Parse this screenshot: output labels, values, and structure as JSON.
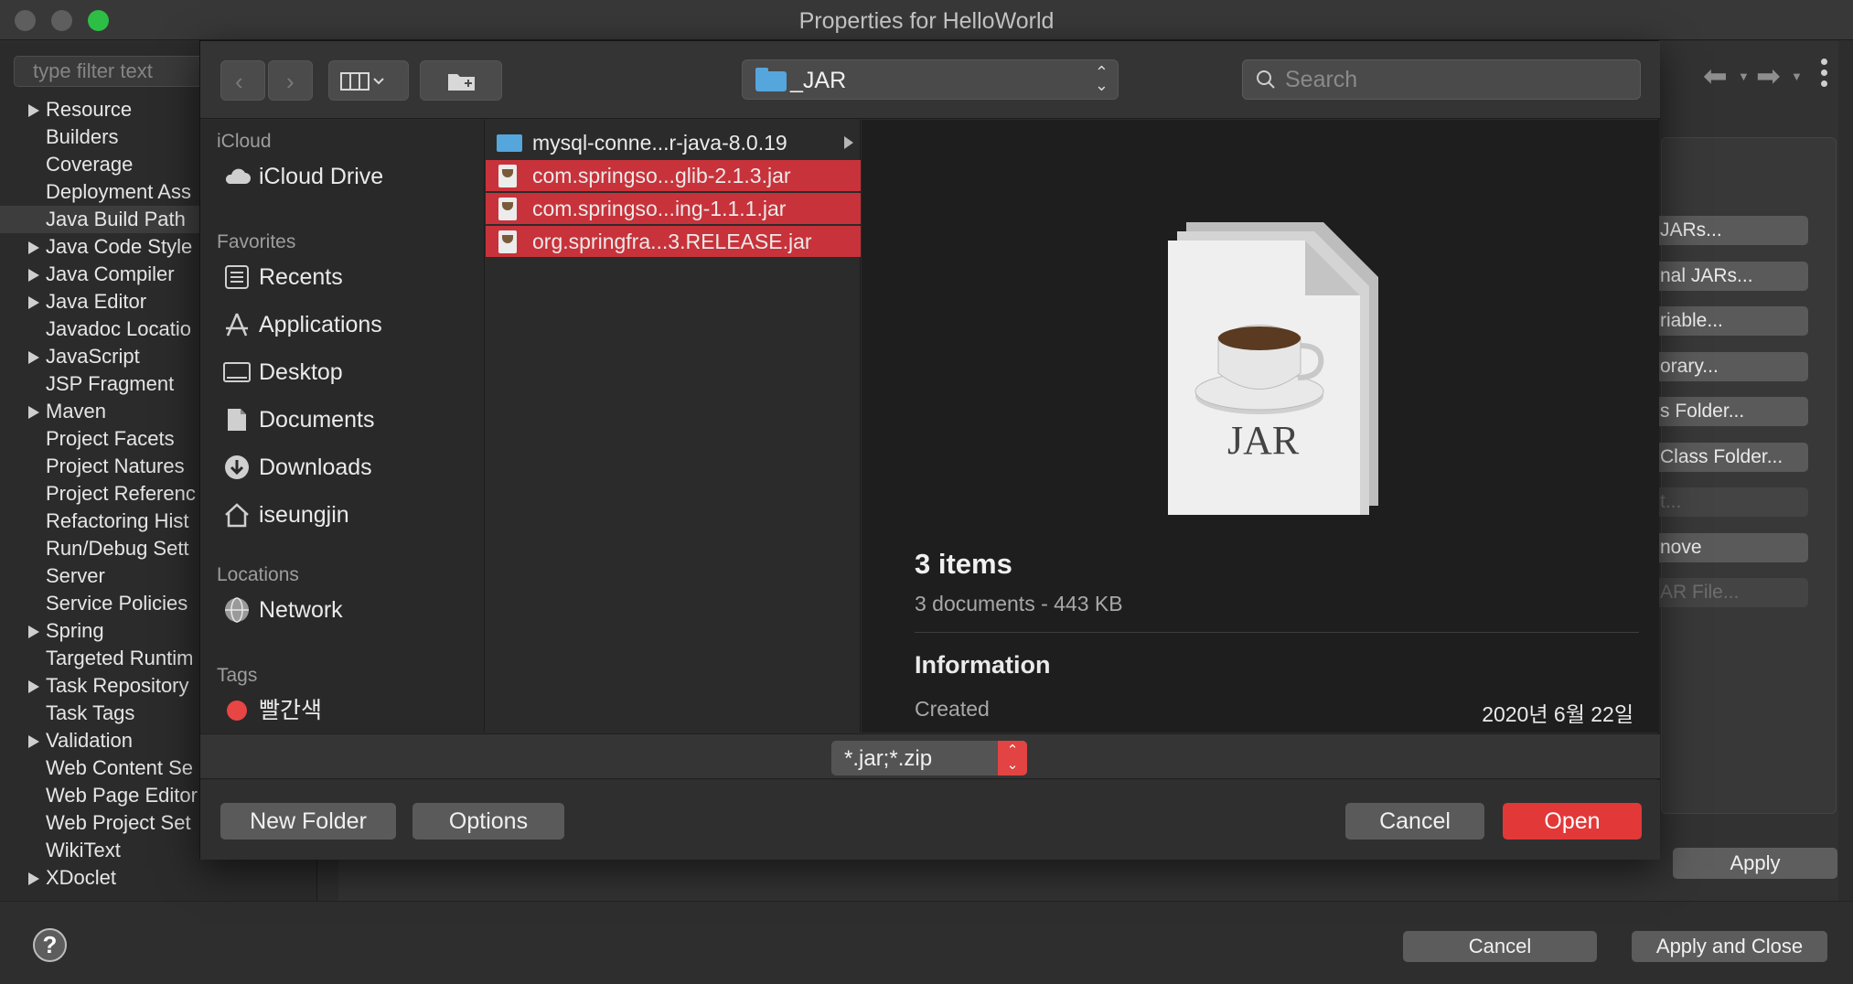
{
  "window": {
    "title": "Properties for HelloWorld"
  },
  "left_panel": {
    "filter_placeholder": "type filter text",
    "items": [
      {
        "label": "Resource",
        "expandable": true
      },
      {
        "label": "Builders",
        "expandable": false
      },
      {
        "label": "Coverage",
        "expandable": false
      },
      {
        "label": "Deployment Ass",
        "expandable": false
      },
      {
        "label": "Java Build Path",
        "expandable": false,
        "selected": true
      },
      {
        "label": "Java Code Style",
        "expandable": true
      },
      {
        "label": "Java Compiler",
        "expandable": true
      },
      {
        "label": "Java Editor",
        "expandable": true
      },
      {
        "label": "Javadoc Locatio",
        "expandable": false
      },
      {
        "label": "JavaScript",
        "expandable": true
      },
      {
        "label": "JSP Fragment",
        "expandable": false
      },
      {
        "label": "Maven",
        "expandable": true
      },
      {
        "label": "Project Facets",
        "expandable": false
      },
      {
        "label": "Project Natures",
        "expandable": false
      },
      {
        "label": "Project Referenc",
        "expandable": false
      },
      {
        "label": "Refactoring Hist",
        "expandable": false
      },
      {
        "label": "Run/Debug Sett",
        "expandable": false
      },
      {
        "label": "Server",
        "expandable": false
      },
      {
        "label": "Service Policies",
        "expandable": false
      },
      {
        "label": "Spring",
        "expandable": true
      },
      {
        "label": "Targeted Runtim",
        "expandable": false
      },
      {
        "label": "Task Repository",
        "expandable": true
      },
      {
        "label": "Task Tags",
        "expandable": false
      },
      {
        "label": "Validation",
        "expandable": true
      },
      {
        "label": "Web Content Se",
        "expandable": false
      },
      {
        "label": "Web Page Editor",
        "expandable": false
      },
      {
        "label": "Web Project Set",
        "expandable": false
      },
      {
        "label": "WikiText",
        "expandable": false
      },
      {
        "label": "XDoclet",
        "expandable": true
      }
    ]
  },
  "right_panel": {
    "side_buttons": [
      {
        "label": "JARs...",
        "disabled": false
      },
      {
        "label": "nal JARs...",
        "disabled": false
      },
      {
        "label": "riable...",
        "disabled": false
      },
      {
        "label": "orary...",
        "disabled": false
      },
      {
        "label": "s Folder...",
        "disabled": false
      },
      {
        "label": "Class Folder...",
        "disabled": false
      },
      {
        "label": "t...",
        "disabled": true
      },
      {
        "label": "nove",
        "disabled": false
      },
      {
        "label": "AR File...",
        "disabled": true
      }
    ],
    "apply_label": "Apply"
  },
  "bottom_bar": {
    "help_label": "?",
    "cancel_label": "Cancel",
    "apply_close_label": "Apply and Close"
  },
  "dialog": {
    "path_label": "_JAR",
    "search_placeholder": "Search",
    "sidebar": {
      "sections": [
        {
          "title": "iCloud",
          "items": [
            {
              "label": "iCloud Drive",
              "icon": "cloud-icon"
            }
          ]
        },
        {
          "title": "Favorites",
          "items": [
            {
              "label": "Recents",
              "icon": "recents-icon"
            },
            {
              "label": "Applications",
              "icon": "applications-icon"
            },
            {
              "label": "Desktop",
              "icon": "desktop-icon"
            },
            {
              "label": "Documents",
              "icon": "documents-icon"
            },
            {
              "label": "Downloads",
              "icon": "downloads-icon"
            },
            {
              "label": "iseungjin",
              "icon": "home-icon"
            }
          ]
        },
        {
          "title": "Locations",
          "items": [
            {
              "label": "Network",
              "icon": "network-icon"
            }
          ]
        },
        {
          "title": "Tags",
          "items": [
            {
              "label": "빨간색",
              "icon": "red-tag-icon",
              "color": "#e84545"
            }
          ]
        }
      ]
    },
    "files": [
      {
        "name": "mysql-conne...r-java-8.0.19",
        "kind": "folder",
        "selected": false
      },
      {
        "name": "com.springso...glib-2.1.3.jar",
        "kind": "jar",
        "selected": true
      },
      {
        "name": "com.springso...ing-1.1.1.jar",
        "kind": "jar",
        "selected": true
      },
      {
        "name": "org.springfra...3.RELEASE.jar",
        "kind": "jar",
        "selected": true
      }
    ],
    "preview": {
      "icon_label": "JAR",
      "count": "3 items",
      "subtitle": "3 documents - 443 KB",
      "info_title": "Information",
      "created_label": "Created",
      "created_value": "2020년 6월 22일"
    },
    "format_label": "*.jar;*.zip",
    "footer": {
      "new_folder_label": "New Folder",
      "options_label": "Options",
      "cancel_label": "Cancel",
      "open_label": "Open"
    }
  },
  "colors": {
    "accent_red": "#e23838",
    "selection_red": "#c8323a",
    "folder_blue": "#54a6dc"
  }
}
